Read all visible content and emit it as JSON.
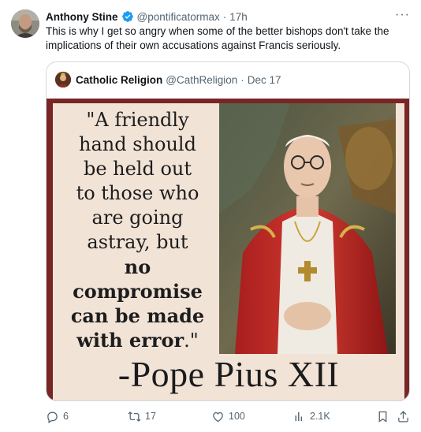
{
  "tweet": {
    "author_name": "Anthony Stine",
    "author_handle": "@pontificatormax",
    "separator": "·",
    "time": "17h",
    "more_label": "···",
    "text": "This is why I get so angry when some of the better bishops don't take the implications of their own accusations against Francis seriously."
  },
  "quoted": {
    "author_name": "Catholic Religion",
    "author_handle": "@CathReligion",
    "separator": "·",
    "time": "Dec 17",
    "image": {
      "quote_lines": [
        "\"A friendly",
        "hand should",
        "be held out",
        "to those who",
        "are going",
        "astray, but"
      ],
      "quote_bold_lines": [
        "no",
        "compromise",
        "can be made"
      ],
      "quote_last_bold": "with error",
      "quote_last_tail": ".\"",
      "attribution": "-Pope Pius XII"
    }
  },
  "actions": {
    "replies": "6",
    "reposts": "17",
    "likes": "100",
    "views": "2.1K"
  },
  "icons": {
    "verified": "verified-badge-icon",
    "reply": "reply-icon",
    "repost": "repost-icon",
    "like": "heart-icon",
    "views": "views-icon",
    "bookmark": "bookmark-icon",
    "share": "share-icon"
  },
  "colors": {
    "text": "#0f1419",
    "secondary": "#536471",
    "verified": "#1d9bf0",
    "border": "#cfd9de",
    "image_frame": "#7a2525",
    "image_background": "#f2e3d7"
  }
}
